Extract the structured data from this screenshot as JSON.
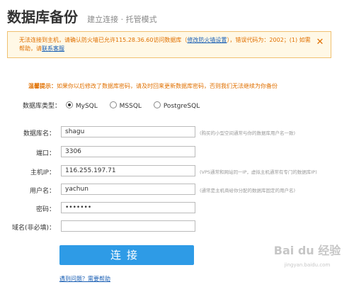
{
  "page": {
    "title": "数据库备份",
    "subtitle": "建立连接 · 托管模式"
  },
  "error": {
    "text1": "无法连接到主机，请确认防火墙已允许",
    "ip": "115.28.36.60",
    "text2": "访问数据库（",
    "link1": "修改防火墙设置",
    "text3": "），错误代码为：2002；(1) 如需帮助，请",
    "link2": "联系客服"
  },
  "warning": {
    "label": "温馨提示：",
    "text": "如果你以后修改了数据库密码，请及时回来更新数据库密码，否则我们无法继续为你备份"
  },
  "db_type": {
    "label": "数据库类型：",
    "options": [
      "MySQL",
      "MSSQL",
      "PostgreSQL"
    ],
    "selected": "MySQL"
  },
  "form": {
    "db_name": {
      "label": "数据库名：",
      "value": "shagu",
      "hint": "(购买的小型空间通常与你的数据库用户名一致)"
    },
    "port": {
      "label": "端口：",
      "value": "3306"
    },
    "host_ip": {
      "label": "主机IP：",
      "value": "116.255.197.71",
      "hint": "(VPS通常和网站同一IP，虚拟主机通常有专门的数据库IP)"
    },
    "username": {
      "label": "用户名：",
      "value": "yachun",
      "hint": "(通常是主机商给你分配的数据库固定的用户名)"
    },
    "password": {
      "label": "密码：",
      "value": "•••••••"
    },
    "domain": {
      "label": "域名(非必填)：",
      "value": ""
    }
  },
  "actions": {
    "connect": "连接",
    "help": "遇到问题？需要帮助"
  },
  "watermark": {
    "logo": "Bai du 经验",
    "url": "jingyan.baidu.com"
  }
}
